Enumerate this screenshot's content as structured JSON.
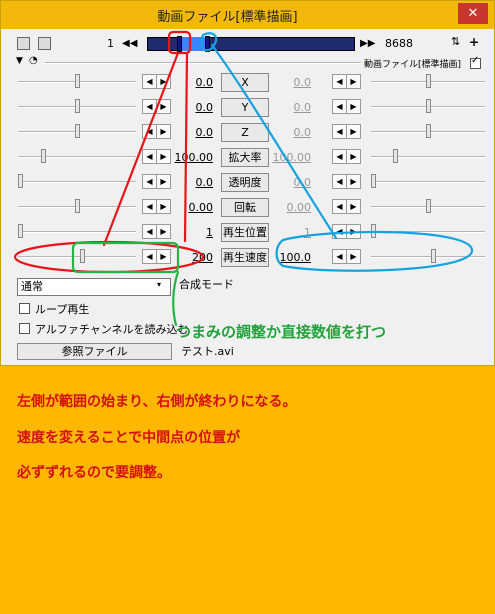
{
  "window": {
    "title": "動画ファイル[標準描画]",
    "close": "✕"
  },
  "toolbar": {
    "frame_start": "1",
    "frame_end": "8688",
    "prev": "◀◀",
    "next": "▶▶",
    "object_label": "動画ファイル[標準描画]"
  },
  "params": [
    {
      "value_left": "0.0",
      "label": "X",
      "value_right": "0.0",
      "slider_fraction": 0.5
    },
    {
      "value_left": "0.0",
      "label": "Y",
      "value_right": "0.0",
      "slider_fraction": 0.5
    },
    {
      "value_left": "0.0",
      "label": "Z",
      "value_right": "0.0",
      "slider_fraction": 0.5
    },
    {
      "value_left": "100.00",
      "label": "拡大率",
      "value_right": "100.00",
      "slider_fraction": 0.2
    },
    {
      "value_left": "0.0",
      "label": "透明度",
      "value_right": "0.0",
      "slider_fraction": 0.0
    },
    {
      "value_left": "0.00",
      "label": "回転",
      "value_right": "0.00",
      "slider_fraction": 0.5
    },
    {
      "value_left": "1",
      "label": "再生位置",
      "value_right": "1",
      "slider_fraction": 0.0
    },
    {
      "value_left": "200",
      "label": "再生速度",
      "value_right": "100.0",
      "slider_fraction": 0.55
    }
  ],
  "blend": {
    "label": "合成モード",
    "selected": "通常",
    "arrow": "▾"
  },
  "checkboxes": {
    "loop": "ループ再生",
    "alpha": "アルファチャンネルを読み込む"
  },
  "file": {
    "button": "参照ファイル",
    "name": "テスト.avi"
  },
  "annotations": {
    "callout": "つまみの調整か直接数値を打つ",
    "notes": [
      "左側が範囲の始まり、右側が終わりになる。",
      "速度を変えることで中間点の位置が",
      "必ずずれるので要調整。"
    ]
  },
  "colors": {
    "background": "#ffb700",
    "titlebar": "#f2b90c",
    "note_red": "#d51010",
    "callout_green": "#1fa33a",
    "circle_red": "#e8141b",
    "circle_blue": "#14a2e0",
    "circle_green": "#23b544"
  }
}
